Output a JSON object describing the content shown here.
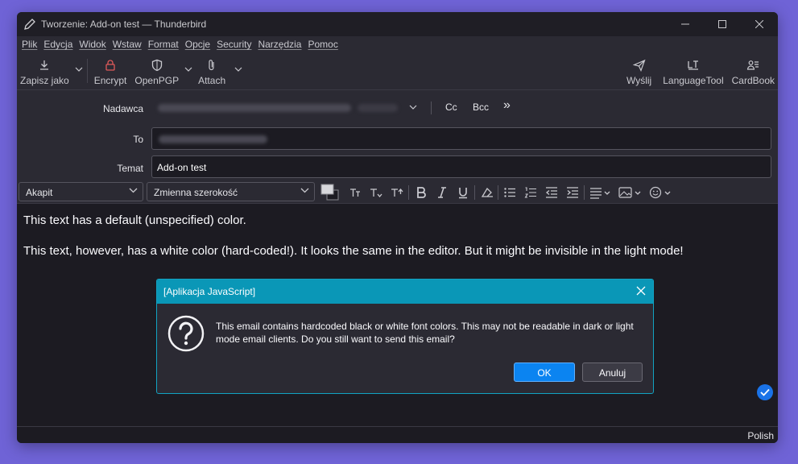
{
  "window": {
    "title": "Tworzenie: Add-on test — Thunderbird"
  },
  "menu": [
    "Plik",
    "Edycja",
    "Widok",
    "Wstaw",
    "Format",
    "Opcje",
    "Security",
    "Narzędzia",
    "Pomoc"
  ],
  "toolbar": {
    "save_label": "Zapisz jako",
    "encrypt_label": "Encrypt",
    "openpgp_label": "OpenPGP",
    "attach_label": "Attach",
    "send_label": "Wyślij",
    "languagetool_label": "LanguageTool",
    "cardbook_label": "CardBook"
  },
  "headers": {
    "from_label": "Nadawca",
    "to_label": "To",
    "subject_label": "Temat",
    "subject_value": "Add-on test",
    "cc_label": "Cc",
    "bcc_label": "Bcc",
    "more_label": "»"
  },
  "format": {
    "paragraph_select": "Akapit",
    "font_select": "Zmienna szerokość"
  },
  "body": {
    "line1": "This text has a default (unspecified) color.",
    "line2": "This text, however, has a white color (hard-coded!). It looks the same in the editor. But it might be invisible in the light mode!"
  },
  "dialog": {
    "title": "[Aplikacja JavaScript]",
    "message": "This email contains hardcoded black or white font colors. This may not be readable in dark or light mode email clients. Do you still want to send this email?",
    "ok_label": "OK",
    "cancel_label": "Anuluj"
  },
  "status": {
    "language": "Polish"
  },
  "colors": {
    "accent": "#0b84f1",
    "dialog_title": "#0a97b7",
    "background": "#6f63d6"
  }
}
